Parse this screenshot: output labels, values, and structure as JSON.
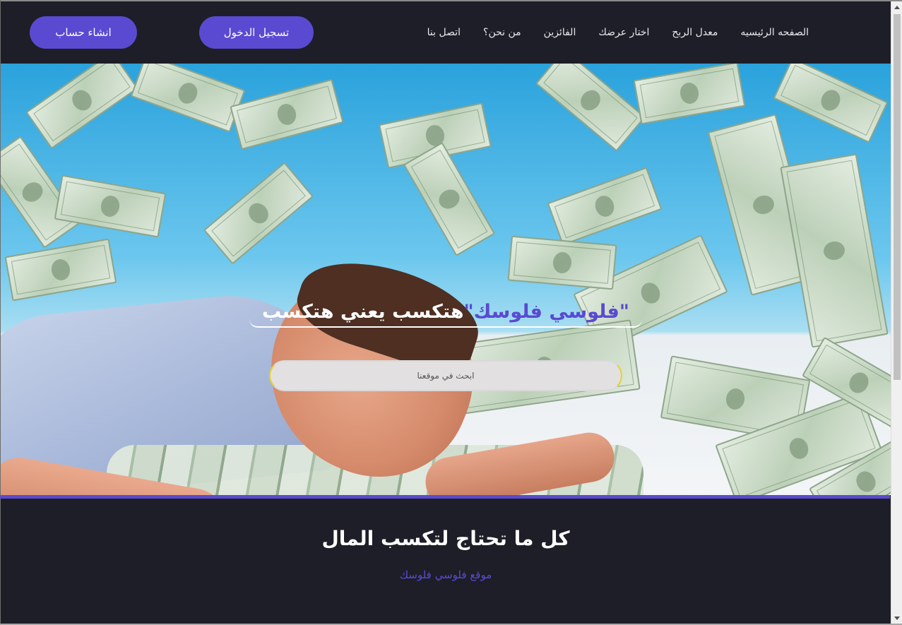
{
  "nav": {
    "signup_label": "انشاء حساب",
    "login_label": "تسجيل الدخول",
    "links": [
      {
        "label": "الصفحه الرئيسيه"
      },
      {
        "label": "معدل الربح"
      },
      {
        "label": "اختار عرضك"
      },
      {
        "label": "الفائزين"
      },
      {
        "label": "من نحن؟"
      },
      {
        "label": "اتصل بنا"
      }
    ]
  },
  "hero": {
    "title_plain": "هتكسب يعني هتكسب",
    "title_accent": "\"فلوسي فلوسك\"",
    "search_placeholder": "ابحث في موقعنا"
  },
  "section": {
    "title": "كل ما تحتاج لتكسب المال",
    "subtitle": "موقع فلوسي فلوسك"
  },
  "colors": {
    "accent": "#5a4ad1",
    "background": "#1d1e27",
    "search_border": "#e7d22b"
  },
  "icons": {
    "scroll_up": "scroll-up-arrow-icon",
    "scroll_down": "scroll-down-arrow-icon"
  }
}
